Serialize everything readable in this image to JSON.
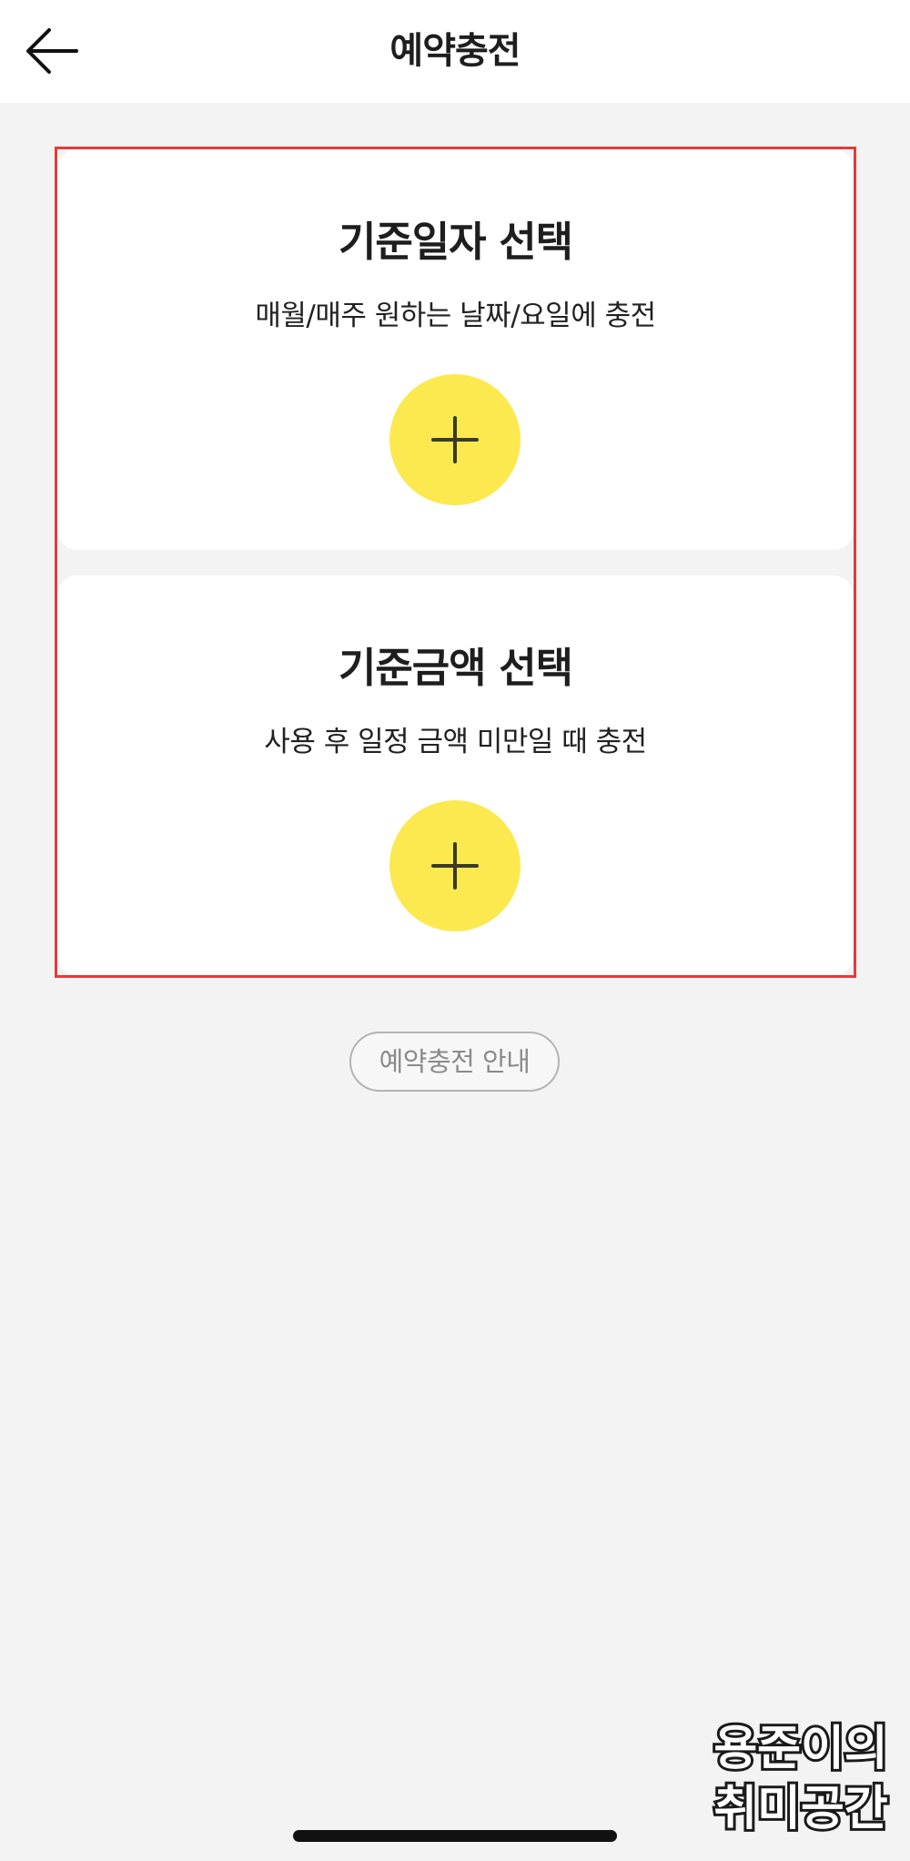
{
  "header": {
    "title": "예약충전",
    "back_icon": "arrow-left-icon"
  },
  "cards": [
    {
      "title": "기준일자 선택",
      "description": "매월/매주 원하는 날짜/요일에 충전",
      "add_icon": "plus-icon"
    },
    {
      "title": "기준금액 선택",
      "description": "사용 후 일정 금액 미만일 때 충전",
      "add_icon": "plus-icon"
    }
  ],
  "guide_button": {
    "label": "예약충전 안내"
  },
  "watermark": {
    "line1": "용준이의",
    "line2": "취미공간"
  },
  "colors": {
    "accent_yellow": "#fbe94f",
    "highlight_red": "#e23b3b",
    "background": "#f3f3f3"
  }
}
